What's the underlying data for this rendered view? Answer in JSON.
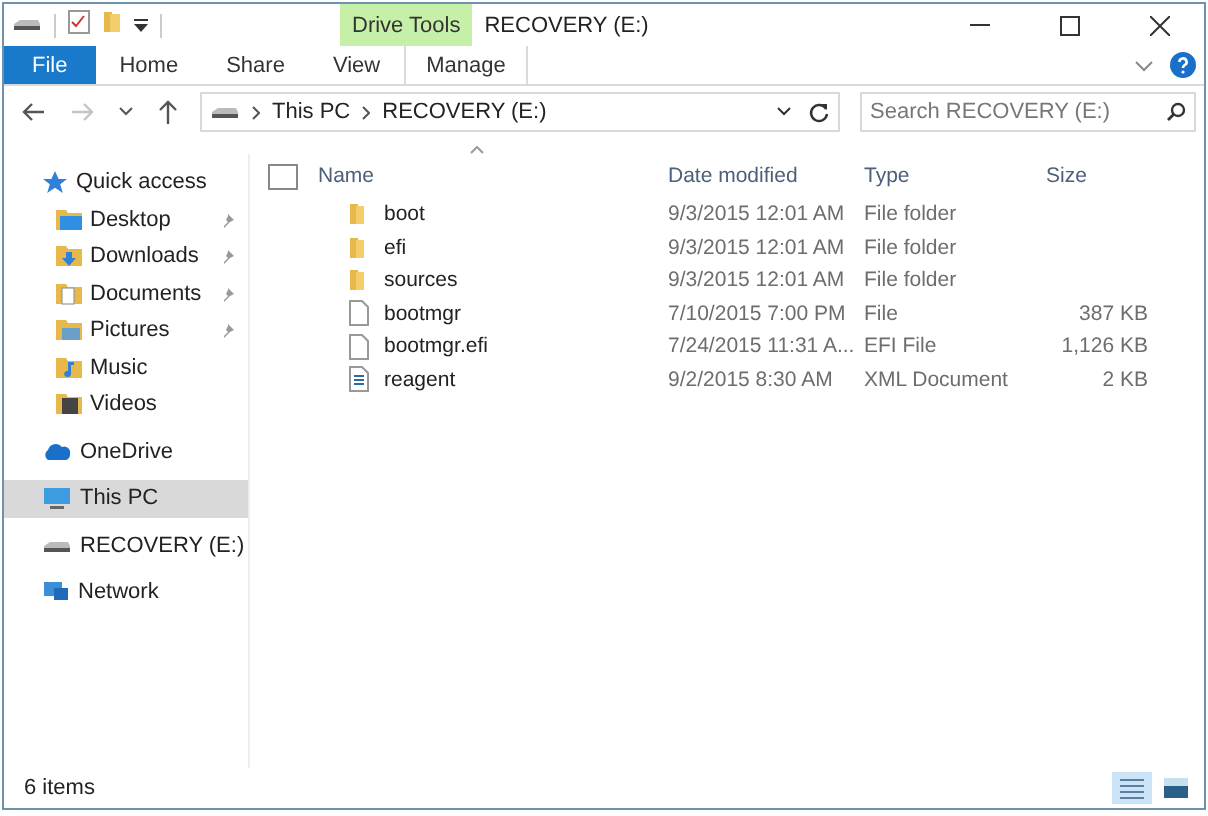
{
  "window": {
    "title": "RECOVERY (E:)",
    "context_tab_group": "Drive Tools"
  },
  "ribbon_tabs": [
    {
      "label": "File",
      "kind": "file",
      "selected": false
    },
    {
      "label": "Home",
      "kind": "tab",
      "selected": false
    },
    {
      "label": "Share",
      "kind": "tab",
      "selected": false
    },
    {
      "label": "View",
      "kind": "tab",
      "selected": false
    },
    {
      "label": "Manage",
      "kind": "context",
      "selected": false
    }
  ],
  "navigation": {
    "back_disabled": false,
    "forward_disabled": true
  },
  "address_bar": {
    "crumbs": [
      "This PC",
      "RECOVERY (E:)"
    ]
  },
  "search": {
    "placeholder": "Search RECOVERY (E:)"
  },
  "sidebar": {
    "items": [
      {
        "label": "Quick access",
        "kind": "star",
        "pinned": false,
        "selected": false,
        "children": [
          {
            "label": "Desktop",
            "kind": "desktop",
            "pinned": true,
            "selected": false
          },
          {
            "label": "Downloads",
            "kind": "downloads",
            "pinned": true,
            "selected": false
          },
          {
            "label": "Documents",
            "kind": "documents",
            "pinned": true,
            "selected": false
          },
          {
            "label": "Pictures",
            "kind": "pictures",
            "pinned": true,
            "selected": false
          },
          {
            "label": "Music",
            "kind": "music",
            "pinned": false,
            "selected": false
          },
          {
            "label": "Videos",
            "kind": "videos",
            "pinned": false,
            "selected": false
          }
        ]
      },
      {
        "label": "OneDrive",
        "kind": "cloud",
        "pinned": false,
        "selected": false
      },
      {
        "label": "This PC",
        "kind": "pc",
        "pinned": false,
        "selected": true
      },
      {
        "label": "RECOVERY (E:)",
        "kind": "drive",
        "pinned": false,
        "selected": false
      },
      {
        "label": "Network",
        "kind": "network",
        "pinned": false,
        "selected": false
      }
    ]
  },
  "table": {
    "select_all_checked": false,
    "columns": [
      "Name",
      "Date modified",
      "Type",
      "Size"
    ],
    "rows": [
      {
        "kind": "folder",
        "name": "boot",
        "date": "9/3/2015 12:01 AM",
        "type": "File folder"
      },
      {
        "kind": "folder",
        "name": "efi",
        "date": "9/3/2015 12:01 AM",
        "type": "File folder"
      },
      {
        "kind": "folder",
        "name": "sources",
        "date": "9/3/2015 12:01 AM",
        "type": "File folder"
      },
      {
        "kind": "file",
        "name": "bootmgr",
        "date": "7/10/2015 7:00 PM",
        "type": "File",
        "size": "387 KB"
      },
      {
        "kind": "file",
        "name": "bootmgr.efi",
        "date": "7/24/2015 11:31 A...",
        "type": "EFI File",
        "size": "1,126 KB"
      },
      {
        "kind": "xml",
        "name": "reagent",
        "date": "9/2/2015 8:30 AM",
        "type": "XML Document",
        "size": "2 KB"
      }
    ]
  },
  "status_bar": {
    "text": "6 items"
  },
  "view_buttons": [
    {
      "kind": "details",
      "selected": true
    },
    {
      "kind": "large-icons",
      "selected": false
    }
  ]
}
